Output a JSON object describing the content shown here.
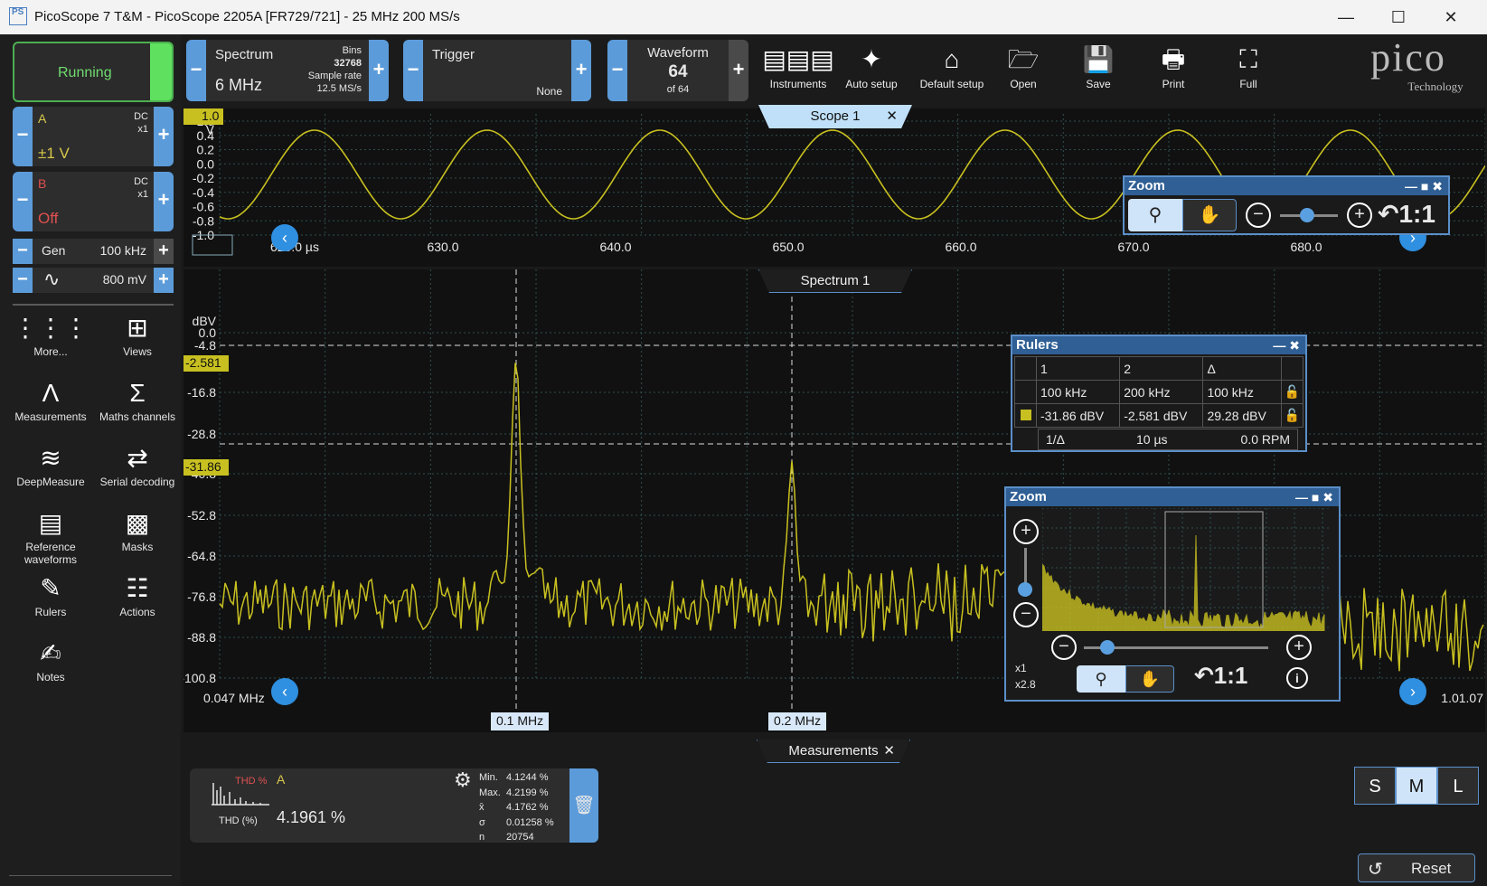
{
  "window": {
    "title": "PicoScope 7 T&M  -  PicoScope 2205A [FR729/721] - 25 MHz 200 MS/s",
    "logo": "PS"
  },
  "controls": {
    "run_label": "Running",
    "channel_a": {
      "name": "A",
      "coupling": "DC",
      "probe": "x1",
      "range": "±1 V"
    },
    "channel_b": {
      "name": "B",
      "coupling": "DC",
      "probe": "x1",
      "range": "Off"
    },
    "gen": {
      "label": "Gen",
      "freq": "100 kHz",
      "amplitude": "800 mV"
    }
  },
  "left_tools": [
    {
      "label": "More...",
      "icon": "grid-dots-icon"
    },
    {
      "label": "Views",
      "icon": "views-grid-icon"
    },
    {
      "label": "Measurements",
      "icon": "measurement-icon"
    },
    {
      "label": "Maths channels",
      "icon": "sigma-icon"
    },
    {
      "label": "DeepMeasure",
      "icon": "deepmeasure-icon"
    },
    {
      "label": "Serial decoding",
      "icon": "serial-decoding-icon"
    },
    {
      "label": "Reference waveforms",
      "icon": "reference-waveform-icon"
    },
    {
      "label": "Masks",
      "icon": "masks-icon"
    },
    {
      "label": "Rulers",
      "icon": "ruler-icon"
    },
    {
      "label": "Actions",
      "icon": "clapper-icon"
    },
    {
      "label": "Notes",
      "icon": "notes-icon"
    }
  ],
  "toolbar": {
    "spectrum": {
      "label": "Spectrum",
      "value": "6 MHz",
      "bins_label": "Bins",
      "bins": "32768",
      "rate_label": "Sample rate",
      "rate": "12.5 MS/s"
    },
    "trigger": {
      "label": "Trigger",
      "mode": "None"
    },
    "waveform": {
      "label": "Waveform",
      "value": "64",
      "of": "of 64"
    },
    "buttons": [
      {
        "label": "Instruments",
        "icon": "instruments-icon"
      },
      {
        "label": "Auto setup",
        "icon": "magic-wand-icon"
      },
      {
        "label": "Default setup",
        "icon": "default-setup-icon"
      },
      {
        "label": "Open",
        "icon": "folder-icon"
      },
      {
        "label": "Save",
        "icon": "save-icon"
      },
      {
        "label": "Print",
        "icon": "print-icon"
      },
      {
        "label": "Full",
        "icon": "fullscreen-icon"
      }
    ],
    "brand": "pico",
    "brand_sub": "Technology"
  },
  "scope": {
    "tab": "Scope 1",
    "unit": "V",
    "y_ticks": [
      "1.0",
      "0.4",
      "0.2",
      "0.0",
      "-0.2",
      "-0.4",
      "-0.6",
      "-0.8",
      "-1.0"
    ],
    "x_ticks": [
      "620.0 µs",
      "630.0",
      "640.0",
      "650.0",
      "660.0",
      "670.0",
      "680.0"
    ]
  },
  "spectrum_view": {
    "tab": "Spectrum 1",
    "unit": "dBV",
    "y_ticks": [
      "0.0",
      "-4.8",
      "-16.8",
      "-28.8",
      "-40.8",
      "-52.8",
      "-64.8",
      "-76.8",
      "-88.8",
      "-100.8"
    ],
    "ruler_labels": [
      "-2.581",
      "-31.86"
    ],
    "x_left": "0.047 MHz",
    "x_right": "1.01.07",
    "marker_1": "0.1 MHz",
    "marker_2": "0.2 MHz"
  },
  "zoom_top": {
    "title": "Zoom",
    "ratio": "1:1"
  },
  "rulers": {
    "title": "Rulers",
    "headers": [
      "1",
      "2",
      "Δ"
    ],
    "row1": [
      "100 kHz",
      "200 kHz",
      "100 kHz"
    ],
    "row2": [
      "-31.86 dBV",
      "-2.581 dBV",
      "29.28 dBV"
    ],
    "row3": [
      "1/Δ",
      "10 µs",
      "0.0 RPM"
    ]
  },
  "zoom_spec": {
    "title": "Zoom",
    "ratio": "1:1",
    "x1": "x1",
    "x2": "x2.8"
  },
  "measurements": {
    "tab": "Measurements",
    "channel": "A",
    "thumb_label": "THD %",
    "name": "THD (%)",
    "value": "4.1961 %",
    "stats_labels": [
      "Min.",
      "Max.",
      "x̄",
      "σ",
      "n"
    ],
    "stats_values": [
      "4.1244 %",
      "4.2199 %",
      "4.1762 %",
      "0.01258 %",
      "20754"
    ]
  },
  "size_buttons": [
    "S",
    "M",
    "L"
  ],
  "reset_label": "Reset",
  "colors": {
    "trace": "#c8c020",
    "accent": "#5c9bd9",
    "running": "#5fe05f",
    "channel_b": "#e05050"
  }
}
